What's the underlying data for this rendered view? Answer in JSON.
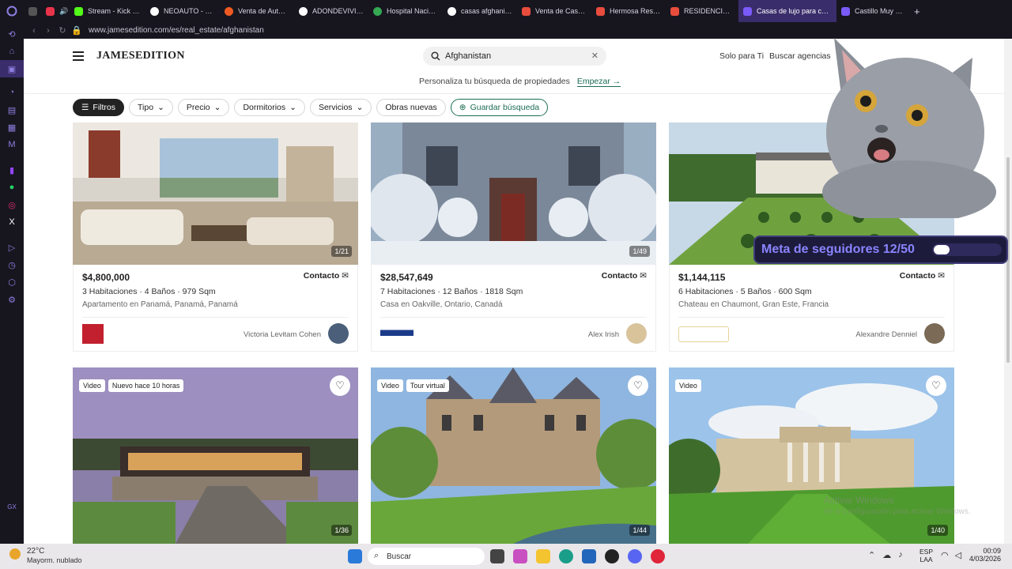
{
  "tabs": [
    {
      "label": "Stream - Kick Da",
      "color": "#53fc18"
    },
    {
      "label": "NEOAUTO - Busc",
      "color": "#ffffff"
    },
    {
      "label": "Venta de Autos s",
      "color": "#f05a22"
    },
    {
      "label": "ADONDEVIVIR - ",
      "color": "#ffffff"
    },
    {
      "label": "Hospital Naciona",
      "color": "#34a853"
    },
    {
      "label": "casas afghanista",
      "color": "#ffffff"
    },
    {
      "label": "Venta de Casas a",
      "color": "#e84c3d"
    },
    {
      "label": "Hermosa Reside",
      "color": "#e84c3d"
    },
    {
      "label": "RESIDENCIA EXC",
      "color": "#e84c3d"
    },
    {
      "label": "Casas de lujo para compr",
      "color": "#7a5af8",
      "active": true
    },
    {
      "label": "Castillo Muy Eleg",
      "color": "#7a5af8"
    }
  ],
  "address": {
    "url": "www.jamesedition.com/es/real_estate/afghanistan"
  },
  "header": {
    "logo": "JAMESEDITION",
    "search_value": "Afghanistan",
    "nav_1": "Solo para Ti",
    "nav_2": "Buscar agencias",
    "personaliza": "Personaliza tu búsqueda de propiedades",
    "empezar": "Empezar →"
  },
  "filters": {
    "filtros": "Filtros",
    "tipo": "Tipo",
    "precio": "Precio",
    "dormitorios": "Dormitorios",
    "servicios": "Servicios",
    "obras": "Obras nuevas",
    "guardar": "Guardar búsqueda"
  },
  "listings": [
    {
      "counter": "1/21",
      "price": "$4,800,000",
      "contact": "Contacto",
      "specs": "3 Habitaciones · 4 Baños · 979 Sqm",
      "location": "Apartamento en Panamá, Panamá, Panamá",
      "agent": "Victoria Levitam Cohen"
    },
    {
      "counter": "1/49",
      "price": "$28,547,649",
      "contact": "Contacto",
      "specs": "7 Habitaciones · 12 Baños · 1818 Sqm",
      "location": "Casa en Oakville, Ontario, Canadá",
      "agent": "Alex Irish"
    },
    {
      "counter": "",
      "price": "$1,144,115",
      "contact": "Contacto",
      "specs": "6 Habitaciones · 5 Baños · 600 Sqm",
      "location": "Chateau en Chaumont, Gran Este, Francia",
      "agent": "Alexandre Denniel"
    }
  ],
  "listings2": [
    {
      "counter": "1/36",
      "badge1": "Video",
      "badge2": "Nuevo hace 10 horas"
    },
    {
      "counter": "1/44",
      "badge1": "Video",
      "badge2": "Tour virtual"
    },
    {
      "counter": "1/40",
      "badge1": "Video",
      "badge2": ""
    }
  ],
  "watermark": {
    "line1": "Activar Windows",
    "line2": "Ve a Configuración para activar Windows."
  },
  "overlay": {
    "meta": "Meta de seguidores 12/50"
  },
  "taskbar": {
    "temp": "22°C",
    "weather": "Mayorm. nublado",
    "search": "Buscar",
    "lang1": "ESP",
    "lang2": "LAA",
    "time": "00:09",
    "date": "4/03/2026"
  }
}
